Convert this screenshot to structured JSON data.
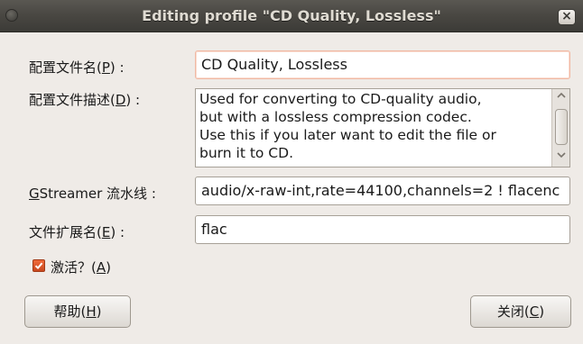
{
  "window": {
    "title": "Editing profile \"CD Quality, Lossless\"",
    "close_label": "×"
  },
  "form": {
    "name_label_prefix": "配置文件名(",
    "name_label_mnemonic": "P",
    "name_label_suffix": ") :",
    "name_value": "CD Quality, Lossless",
    "desc_label_prefix": "配置文件描述(",
    "desc_label_mnemonic": "D",
    "desc_label_suffix": ") :",
    "desc_lines": [
      "Used for converting to CD-quality audio,",
      "but with a lossless compression codec.",
      "Use this if you later want to edit the file or",
      "burn it to CD."
    ],
    "pipeline_label_mnemonic": "G",
    "pipeline_label_suffix": "Streamer 流水线 :",
    "pipeline_value": "audio/x-raw-int,rate=44100,channels=2 ! flacenc",
    "ext_label_prefix": "文件扩展名(",
    "ext_label_mnemonic": "E",
    "ext_label_suffix": ") :",
    "ext_value": "flac",
    "active_label_prefix": "激活？(",
    "active_label_mnemonic": "A",
    "active_label_suffix": ")",
    "active_checked": true
  },
  "buttons": {
    "help_prefix": "帮助(",
    "help_mnemonic": "H",
    "help_suffix": ")",
    "close_prefix": "关闭(",
    "close_mnemonic": "C",
    "close_suffix": ")"
  },
  "icons": {
    "menu": "window-menu-icon",
    "close": "close-icon",
    "check": "checkmark-icon",
    "scroll_up": "chevron-up-icon",
    "scroll_down": "chevron-down-icon"
  },
  "colors": {
    "titlebar": "#3c3b37",
    "window_bg": "#efebe7",
    "checkbox": "#e0572a",
    "focus_border": "#f0b8a3"
  }
}
